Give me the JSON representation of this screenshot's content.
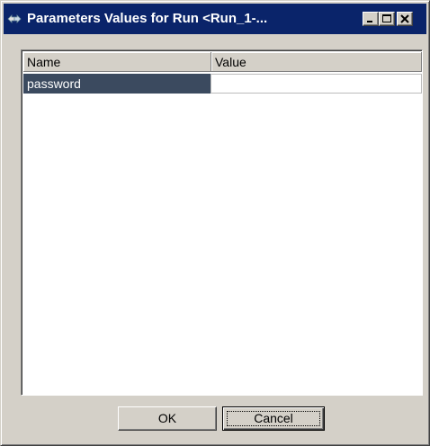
{
  "window": {
    "title": "Parameters Values for Run <Run_1-...",
    "controls": {
      "minimize_icon": "minimize-icon",
      "maximize_icon": "maximize-icon",
      "close_icon": "close-icon"
    }
  },
  "grid": {
    "columns": [
      "Name",
      "Value"
    ],
    "rows": [
      {
        "name": "password",
        "value": ""
      }
    ]
  },
  "buttons": {
    "ok": "OK",
    "cancel": "Cancel"
  },
  "colors": {
    "titlebar": "#0a246a",
    "selected_row": "#3b4a5f",
    "face": "#d4d0c8"
  }
}
